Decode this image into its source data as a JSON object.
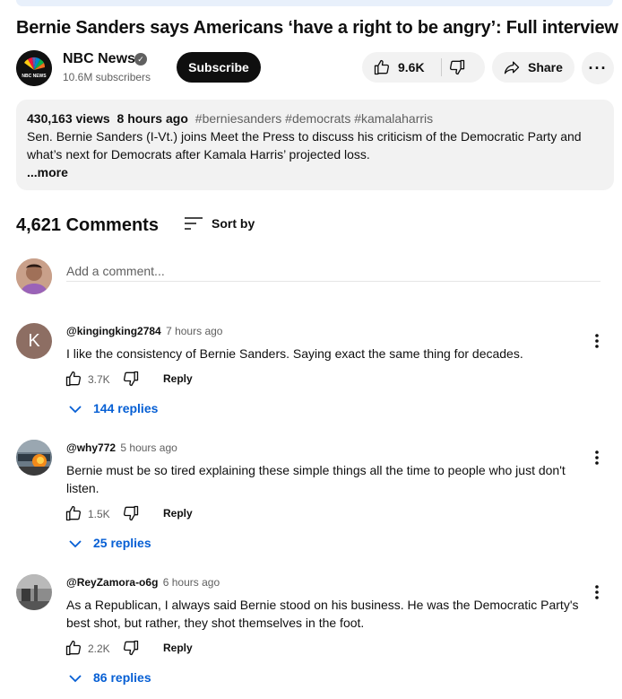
{
  "video": {
    "title": "Bernie Sanders says Americans ‘have a right to be angry’: Full interview"
  },
  "channel": {
    "name": "NBC News",
    "subscribers": "10.6M subscribers",
    "logo_text": "NBC NEWS",
    "subscribe_label": "Subscribe"
  },
  "actions": {
    "likes": "9.6K",
    "share_label": "Share",
    "more_label": "···"
  },
  "description": {
    "views": "430,163 views",
    "age": "8 hours ago",
    "tags": "#berniesanders #democrats #kamalaharris",
    "text": "Sen. Bernie Sanders (I-Vt.) joins Meet the Press to discuss his criticism of the Democratic Party and what’s next for Democrats after Kamala Harris’ projected loss.",
    "more_label": "...more"
  },
  "comments": {
    "count_label": "4,621 Comments",
    "sort_label": "Sort by",
    "add_placeholder": "Add a comment...",
    "reply_label": "Reply",
    "items": [
      {
        "author": "@kingingking2784",
        "time": "7 hours ago",
        "avatar_letter": "K",
        "avatar_color": "#8d6e63",
        "text": "I like the consistency of Bernie Sanders. Saying exact the same thing for decades.",
        "likes": "3.7K",
        "replies": "144 replies"
      },
      {
        "author": "@why772",
        "time": "5 hours ago",
        "text": "Bernie must be so tired explaining these simple things all the time to people who just don't listen.",
        "likes": "1.5K",
        "replies": "25 replies"
      },
      {
        "author": "@ReyZamora-o6g",
        "time": "6 hours ago",
        "text": "As a Republican, I always said Bernie stood on his business. He was the Democratic Party's best shot, but rather, they shot themselves in the foot.",
        "likes": "2.2K",
        "replies": "86 replies"
      }
    ]
  },
  "colors": {
    "link_blue": "#065fd4",
    "chip_bg": "#f2f2f2",
    "subscribe_bg": "#0f0f0f"
  }
}
